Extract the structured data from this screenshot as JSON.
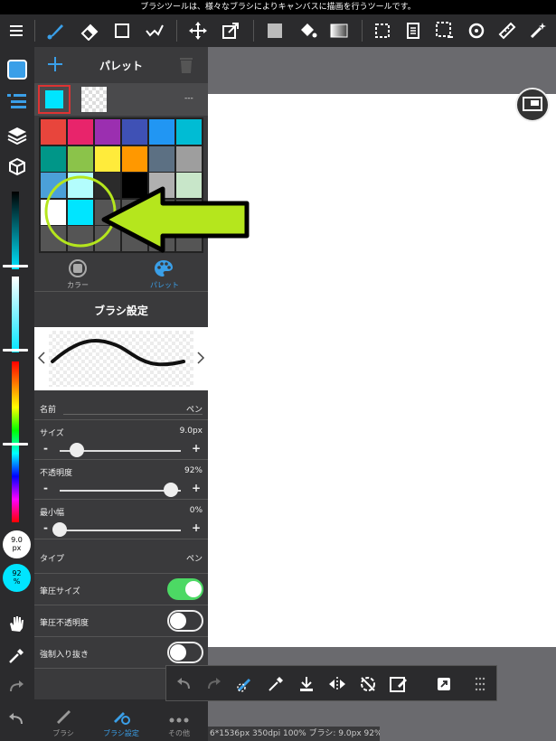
{
  "status_bar": {
    "text": "ブラシツールは、様々なブラシによりキャンバスに描画を行うツールです。"
  },
  "palette": {
    "title": "パレット",
    "mode_label": "---",
    "colors": [
      "#e8453c",
      "#e8246b",
      "#9b2fb0",
      "#3f51b5",
      "#2196f3",
      "#00bcd4",
      "#009688",
      "#8bc34a",
      "#ffeb3b",
      "#ff9800",
      "#5c7083",
      "#9e9e9e",
      "#4ba0d8",
      "#b3fdfd",
      "#2b2b2b",
      "#000000",
      "#b0b0b0",
      "#c8e6c9",
      "#ffffff",
      "#00e5ff",
      "#555555",
      "#555555",
      "#555555",
      "#555555",
      "#555555",
      "#555555",
      "#555555",
      "#555555",
      "#555555",
      "#555555"
    ],
    "tabs": {
      "color": "カラー",
      "palette": "パレット"
    }
  },
  "brush_settings": {
    "title": "ブラシ設定",
    "name_label": "名前",
    "name_value": "ペン",
    "size_label": "サイズ",
    "size_value": "9.0px",
    "size_fraction": 0.14,
    "opacity_label": "不透明度",
    "opacity_value": "92%",
    "opacity_fraction": 0.92,
    "minwidth_label": "最小幅",
    "minwidth_value": "0%",
    "minwidth_fraction": 0.0,
    "type_label": "タイプ",
    "type_value": "ペン",
    "pressure_size_label": "筆圧サイズ",
    "pressure_size_on": true,
    "pressure_opacity_label": "筆圧不透明度",
    "pressure_opacity_on": false,
    "force_taper_label": "強制入り抜き",
    "force_taper_on": false
  },
  "bottom_tabs": {
    "brush": "ブラシ",
    "brush_settings": "ブラシ設定",
    "other": "その他"
  },
  "left_indicators": {
    "size": "9.0\npx",
    "opacity": "92\n%"
  },
  "status_line": "6*1536px 350dpi 100% ブラシ: 9.0px 92%",
  "colors": {
    "accent": "#3a7fd5",
    "current_color": "#00e5ff",
    "toggle_on": "#4cd964",
    "arrow": "#b5e61d"
  }
}
